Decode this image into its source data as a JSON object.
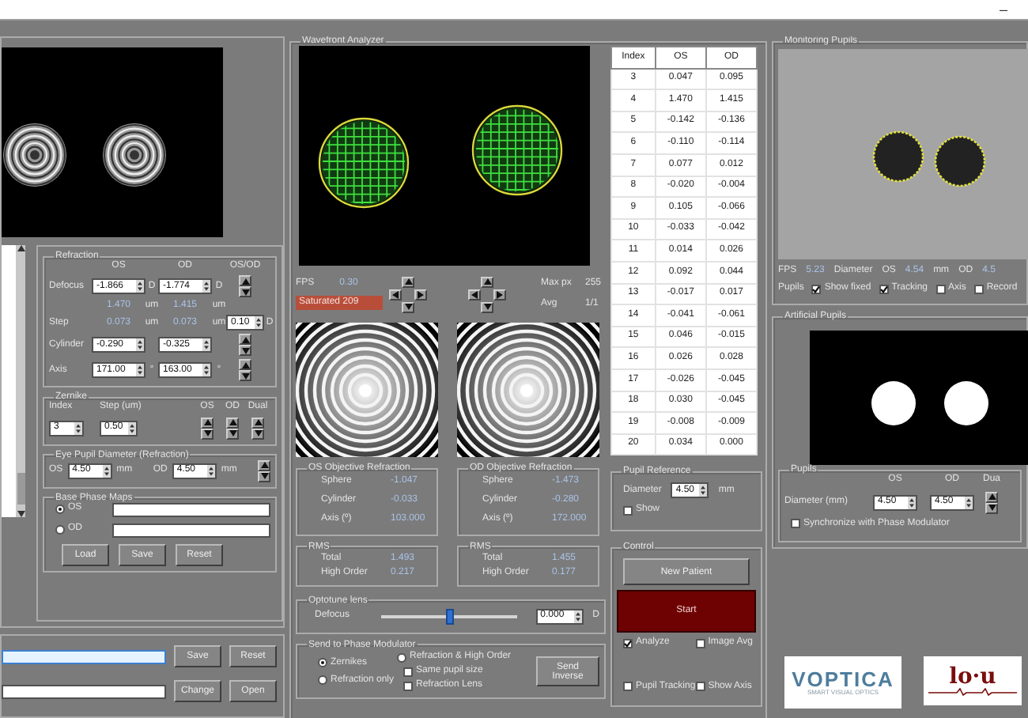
{
  "window": {
    "minimize": "–"
  },
  "left_panel": {
    "refraction": {
      "title": "Refraction",
      "columns": [
        "OS",
        "OD",
        "OS/OD"
      ],
      "rows": [
        {
          "kind": "spin",
          "label": "Defocus",
          "os": "-1.866",
          "os_unit": "D",
          "od": "-1.774",
          "od_unit": "D"
        },
        {
          "kind": "readout",
          "os": "1.470",
          "os_unit": "um",
          "od": "1.415",
          "od_unit": "um"
        },
        {
          "kind": "step",
          "label": "Step",
          "os": "0.073",
          "os_unit": "um",
          "od": "0.073",
          "od_unit": "um",
          "step": "0.10",
          "step_unit": "D"
        },
        {
          "kind": "spin",
          "label": "Cylinder",
          "os": "-0.290",
          "od": "-0.325"
        },
        {
          "kind": "spin",
          "label": "Axis",
          "os": "171.00",
          "os_unit": "°",
          "od": "163.00",
          "od_unit": "°"
        }
      ]
    },
    "zernike": {
      "title": "Zernike",
      "index_label": "Index",
      "index": "3",
      "step_label": "Step (um)",
      "step": "0.50",
      "arrow_labels": [
        "OS",
        "OD",
        "Dual"
      ]
    },
    "eye_pupil_diameter": {
      "title": "Eye Pupil Diameter (Refraction)",
      "os_label": "OS",
      "os": "4.50",
      "os_unit": "mm",
      "od_label": "OD",
      "od": "4.50",
      "od_unit": "mm"
    },
    "base_phase_maps": {
      "title": "Base  Phase Maps",
      "options": [
        {
          "label": "OS",
          "selected": true
        },
        {
          "label": "OD",
          "selected": false
        }
      ],
      "buttons": [
        "Load",
        "Save",
        "Reset"
      ]
    },
    "file_rows": [
      {
        "focused": true,
        "buttons": [
          "Save",
          "Reset"
        ]
      },
      {
        "focused": false,
        "buttons": [
          "Change",
          "Open"
        ]
      }
    ]
  },
  "wavefront_analyzer": {
    "title": "Wavefront Analyzer",
    "fps_label": "FPS",
    "fps": "0.30",
    "saturated": "Saturated 209",
    "max_label": "Max px",
    "max": "255",
    "avg_label": "Avg",
    "avg": "1/1",
    "zernike_table": {
      "columns": [
        "Index",
        "OS",
        "OD"
      ],
      "rows": [
        [
          "3",
          "0.047",
          "0.095"
        ],
        [
          "4",
          "1.470",
          "1.415"
        ],
        [
          "5",
          "-0.142",
          "-0.136"
        ],
        [
          "6",
          "-0.110",
          "-0.114"
        ],
        [
          "7",
          "0.077",
          "0.012"
        ],
        [
          "8",
          "-0.020",
          "-0.004"
        ],
        [
          "9",
          "0.105",
          "-0.066"
        ],
        [
          "10",
          "-0.033",
          "-0.042"
        ],
        [
          "11",
          "0.014",
          "0.026"
        ],
        [
          "12",
          "0.092",
          "0.044"
        ],
        [
          "13",
          "-0.017",
          "0.017"
        ],
        [
          "14",
          "-0.041",
          "-0.061"
        ],
        [
          "15",
          "0.046",
          "-0.015"
        ],
        [
          "16",
          "0.026",
          "0.028"
        ],
        [
          "17",
          "-0.026",
          "-0.045"
        ],
        [
          "18",
          "0.030",
          "-0.045"
        ],
        [
          "19",
          "-0.008",
          "-0.009"
        ],
        [
          "20",
          "0.034",
          "0.000"
        ]
      ]
    },
    "objective_refraction": [
      {
        "title": "OS Objective Refraction",
        "rows": [
          {
            "label": "Sphere",
            "value": "-1.047"
          },
          {
            "label": "Cylinder",
            "value": "-0.033"
          },
          {
            "label": "Axis (º)",
            "value": "103.000"
          }
        ]
      },
      {
        "title": "OD Objective Refraction",
        "rows": [
          {
            "label": "Sphere",
            "value": "-1.473"
          },
          {
            "label": "Cylinder",
            "value": "-0.280"
          },
          {
            "label": "Axis (º)",
            "value": "172.000"
          }
        ]
      }
    ],
    "rms": [
      {
        "title": "RMS",
        "total_label": "Total",
        "total": "1.493",
        "high_label": "High Order",
        "high": "0.217"
      },
      {
        "title": "RMS",
        "total_label": "Total",
        "total": "1.455",
        "high_label": "High Order",
        "high": "0.177"
      }
    ],
    "pupil_reference": {
      "title": "Pupil Reference",
      "diameter_label": "Diameter",
      "diameter": "4.50",
      "unit": "mm",
      "show": {
        "label": "Show",
        "checked": false
      }
    },
    "control": {
      "title": "Control",
      "new_patient": "New Patient",
      "start": "Start",
      "checks": [
        {
          "label": "Analyze",
          "checked": true
        },
        {
          "label": "Image Avg",
          "checked": false
        },
        {
          "label": "Pupil Tracking",
          "checked": false
        },
        {
          "label": "Show Axis",
          "checked": false
        }
      ]
    },
    "optotune": {
      "title": "Optotune lens",
      "label": "Defocus",
      "level": 0.5,
      "value": "0.000",
      "unit": "D"
    },
    "send_to_phase_modulator": {
      "title": "Send to Phase Modulator",
      "options": [
        {
          "label": "Zernikes",
          "selected": true
        },
        {
          "label": "Refraction only",
          "selected": false
        },
        {
          "label": "Refraction & High Order",
          "selected": false
        }
      ],
      "checks": [
        {
          "label": "Same pupil size",
          "checked": false
        },
        {
          "label": "Refraction Lens",
          "checked": false
        }
      ],
      "button": "Send Inverse"
    }
  },
  "monitoring_pupils": {
    "title": "Monitoring Pupils",
    "fps_label": "FPS",
    "fps": "5.23",
    "diameter_label": "Diameter",
    "os_label": "OS",
    "os": "4.54",
    "unit": "mm",
    "od_label": "OD",
    "od": "4.5",
    "pupils_label": "Pupils",
    "checks": [
      {
        "label": "Show fixed",
        "checked": true
      },
      {
        "label": "Tracking",
        "checked": true
      },
      {
        "label": "Axis",
        "checked": false
      },
      {
        "label": "Record",
        "checked": false
      }
    ]
  },
  "artificial_pupils": {
    "title": "Artificial Pupils",
    "pupils": {
      "title": "Pupils",
      "columns": [
        "OS",
        "OD",
        "Dua"
      ],
      "diameter_label": "Diameter (mm)",
      "os": "4.50",
      "od": "4.50",
      "sync": {
        "label": "Synchronize with Phase Modulator",
        "checked": false
      }
    }
  },
  "logos": [
    {
      "text": "VOPTICA",
      "tagline": "SMART VISUAL OPTICS"
    },
    {
      "text": "lo·u"
    }
  ]
}
